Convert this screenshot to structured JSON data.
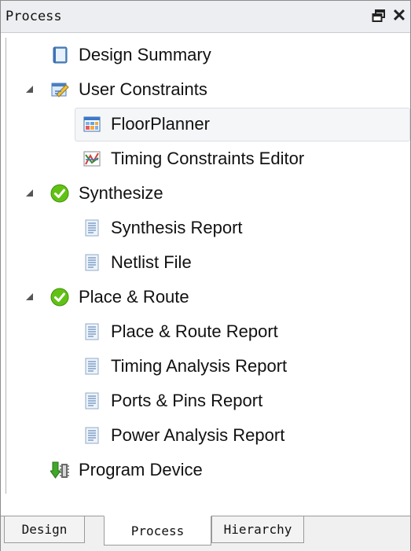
{
  "panel": {
    "title": "Process",
    "float_label": "",
    "close_label": "✕"
  },
  "tree": {
    "items": [
      {
        "label": "Design Summary",
        "icon": "summary-icon"
      },
      {
        "label": "User Constraints",
        "icon": "constraints-icon"
      },
      {
        "label": "FloorPlanner",
        "icon": "floorplanner-icon"
      },
      {
        "label": "Timing Constraints Editor",
        "icon": "timing-editor-icon"
      },
      {
        "label": "Synthesize",
        "icon": "check-icon"
      },
      {
        "label": "Synthesis Report",
        "icon": "report-icon"
      },
      {
        "label": "Netlist File",
        "icon": "report-icon"
      },
      {
        "label": "Place & Route",
        "icon": "check-icon"
      },
      {
        "label": "Place & Route Report",
        "icon": "report-icon"
      },
      {
        "label": "Timing Analysis Report",
        "icon": "report-icon"
      },
      {
        "label": "Ports & Pins Report",
        "icon": "report-icon"
      },
      {
        "label": "Power Analysis Report",
        "icon": "report-icon"
      },
      {
        "label": "Program Device",
        "icon": "program-device-icon"
      }
    ]
  },
  "tabs": [
    {
      "label": "Design"
    },
    {
      "label": "Process"
    },
    {
      "label": "Hierarchy"
    }
  ],
  "colors": {
    "check": "#62c214",
    "accent": "#3b78c9"
  }
}
